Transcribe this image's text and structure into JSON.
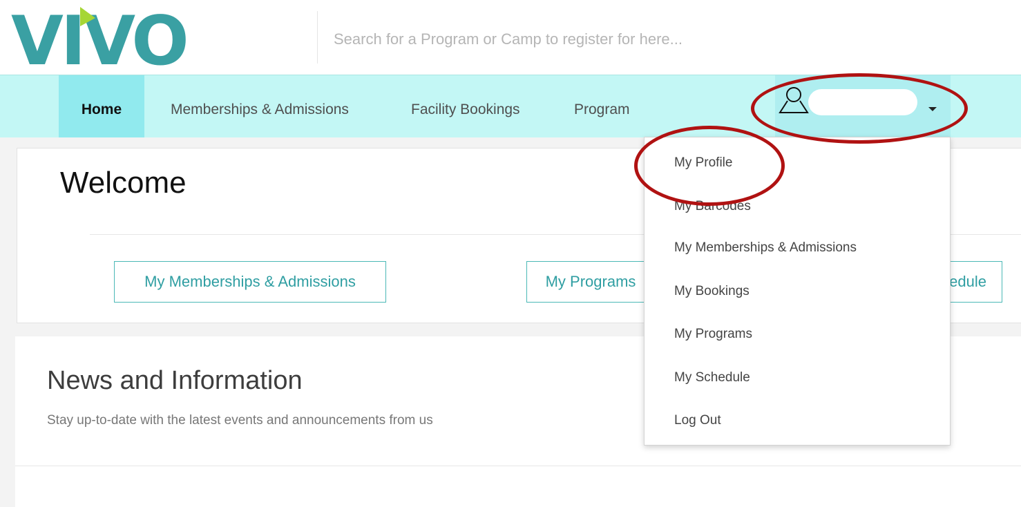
{
  "brand": {
    "logo_text": "VIVO",
    "logo_color": "#3aa0a3",
    "accent_triangle": "#a6d635"
  },
  "search": {
    "placeholder": "Search for a Program or Camp to register for here..."
  },
  "nav": {
    "items": [
      {
        "label": "Home",
        "active": true
      },
      {
        "label": "Memberships & Admissions"
      },
      {
        "label": "Facility Bookings"
      },
      {
        "label": "Program"
      }
    ],
    "user_icon": "user-outline-icon",
    "caret_icon": "caret-down-icon"
  },
  "welcome": {
    "title": "Welcome",
    "buttons": [
      {
        "label": "My Memberships & Admissions"
      },
      {
        "label": "My Programs"
      },
      {
        "label": "My Schedule"
      }
    ]
  },
  "news": {
    "title": "News and Information",
    "subtitle": "Stay up-to-date with the latest events and announcements from us"
  },
  "dropdown": {
    "items": [
      {
        "label": "My Profile"
      },
      {
        "label": "My Barcodes"
      },
      {
        "label": "My Memberships & Admissions"
      },
      {
        "label": "My Bookings"
      },
      {
        "label": "My Programs"
      },
      {
        "label": "My Schedule"
      },
      {
        "label": "Log Out"
      }
    ]
  },
  "colors": {
    "nav_bg": "#c3f7f5",
    "nav_active_bg": "#91eaee",
    "button_border": "#4ab8b6",
    "button_text": "#2f9ea2",
    "annotation": "#b01212"
  }
}
